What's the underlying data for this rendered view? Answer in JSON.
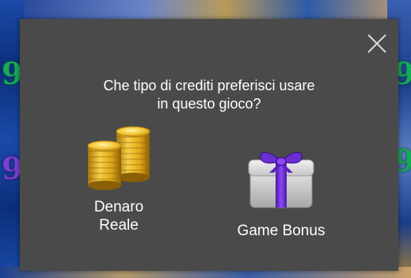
{
  "dialog": {
    "question_line1": "Che tipo di crediti preferisci usare",
    "question_line2": "in questo gioco?",
    "close_icon": "close-icon"
  },
  "options": {
    "real_money": {
      "label_line1": "Denaro",
      "label_line2": "Reale",
      "icon": "gold-coins-icon"
    },
    "game_bonus": {
      "label": "Game Bonus",
      "icon": "gift-box-icon"
    }
  },
  "colors": {
    "modal_background": "#4a4a4a",
    "text": "#ffffff",
    "coin_gold": "#e8b923",
    "gift_silver": "#c9c9c9",
    "ribbon_purple": "#6a2fd0"
  }
}
